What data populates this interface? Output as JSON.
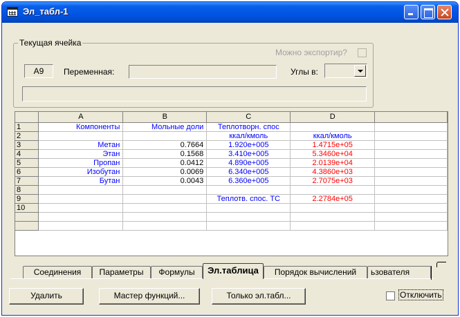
{
  "window": {
    "title": "Эл_табл-1"
  },
  "current_cell": {
    "group_label": "Текущая ячейка",
    "cell_ref": "A9",
    "variable_label": "Переменная:",
    "variable_value": "",
    "export_label": "Можно экспортир?",
    "export_checked": false,
    "angles_label": "Углы в:",
    "angles_value": "",
    "formula_value": ""
  },
  "sheet": {
    "columns": [
      "A",
      "B",
      "C",
      "D",
      ""
    ],
    "rows": [
      {
        "num": "1",
        "cells": [
          "Компоненты",
          "Мольные доли",
          "Теплотворн. спос",
          "",
          ""
        ]
      },
      {
        "num": "2",
        "cells": [
          "",
          "",
          "ккал/кмоль",
          "ккал/кмоль",
          ""
        ]
      },
      {
        "num": "3",
        "cells": [
          "Метан",
          "0.7664",
          "1.920e+005",
          "1.4715e+05",
          ""
        ]
      },
      {
        "num": "4",
        "cells": [
          "Этан",
          "0.1568",
          "3.410e+005",
          "5.3460e+04",
          ""
        ]
      },
      {
        "num": "5",
        "cells": [
          "Пропан",
          "0.0412",
          "4.890e+005",
          "2.0139e+04",
          ""
        ]
      },
      {
        "num": "6",
        "cells": [
          "Изобутан",
          "0.0069",
          "6.340e+005",
          "4.3860e+03",
          ""
        ]
      },
      {
        "num": "7",
        "cells": [
          "Бутан",
          "0.0043",
          "6.360e+005",
          "2.7075e+03",
          ""
        ]
      },
      {
        "num": "8",
        "cells": [
          "",
          "",
          "",
          "",
          ""
        ]
      },
      {
        "num": "9",
        "cells": [
          "",
          "",
          "Теплотв. спос. ТС",
          "2.2784e+05",
          ""
        ]
      },
      {
        "num": "10",
        "cells": [
          "",
          "",
          "",
          "",
          ""
        ]
      },
      {
        "num": "",
        "cells": [
          "",
          "",
          "",
          "",
          ""
        ]
      },
      {
        "num": "",
        "cells": [
          "",
          "",
          "",
          "",
          ""
        ]
      }
    ]
  },
  "tabs": [
    "Соединения",
    "Параметры",
    "Формулы",
    "Эл.таблица",
    "Порядок вычислений",
    "ьзователя"
  ],
  "buttons": {
    "delete": "Удалить",
    "function_wizard": "Мастер функций...",
    "only_table": "Только эл.табл...",
    "disable_label": "Отключить"
  },
  "colors": {
    "blue_text": "#0000ff",
    "red_text": "#ff0000",
    "titlebar": "#0054e3"
  }
}
